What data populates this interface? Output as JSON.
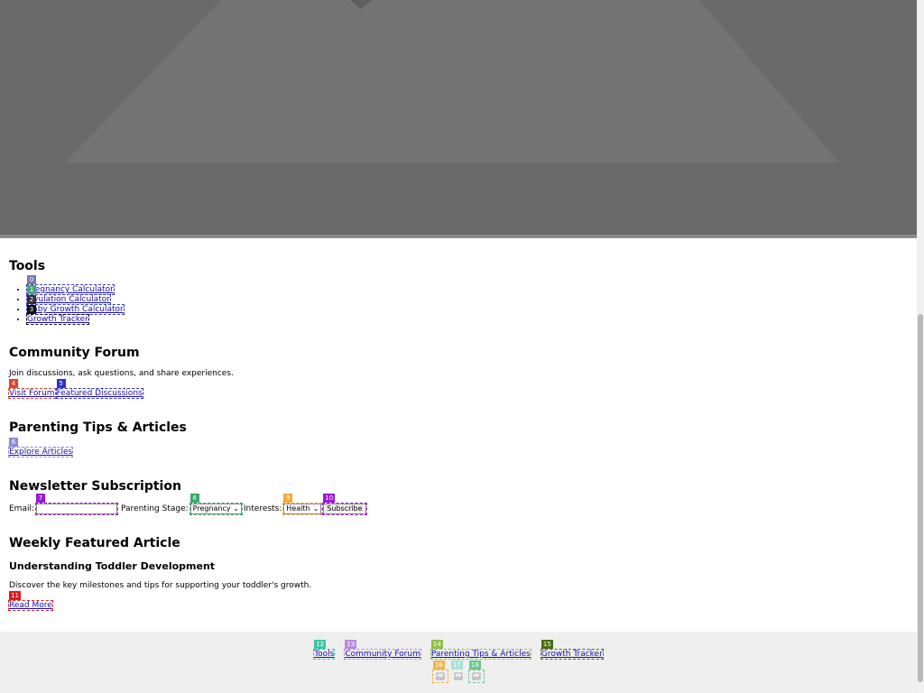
{
  "tools": {
    "title": "Tools",
    "items": [
      {
        "label": "Pregnancy Calculator",
        "badge": "0",
        "color": "#7a7aa8"
      },
      {
        "label": "Ovulation Calculator",
        "badge": "1",
        "color": "#3fae74"
      },
      {
        "label": "Baby Growth Calculator",
        "badge": "2",
        "color": "#333333"
      },
      {
        "label": "Growth Tracker",
        "badge": "3",
        "color": "#111111"
      }
    ]
  },
  "forum": {
    "title": "Community Forum",
    "description": "Join discussions, ask questions, and share experiences.",
    "visit_label": "Visit Forum",
    "visit_badge": "4",
    "featured_label": "Featured Discussions",
    "featured_badge": "5"
  },
  "tips": {
    "title": "Parenting Tips & Articles",
    "explore_label": "Explore Articles",
    "explore_badge": "6"
  },
  "newsletter": {
    "title": "Newsletter Subscription",
    "email_label": "Email:",
    "email_value": "",
    "email_badge": "7",
    "stage_label": "Parenting Stage:",
    "stage_value": "Pregnancy",
    "stage_badge": "8",
    "interests_label": "Interests:",
    "interests_value": "Health",
    "interests_badge": "9",
    "subscribe_label": "Subscribe",
    "subscribe_badge": "10"
  },
  "featured": {
    "title": "Weekly Featured Article",
    "article_title": "Understanding Toddler Development",
    "article_desc": "Discover the key milestones and tips for supporting your toddler's growth.",
    "read_more_label": "Read More",
    "read_more_badge": "11"
  },
  "footer": {
    "links": [
      {
        "label": "Tools",
        "badge": "12",
        "color": "#3ec4a6"
      },
      {
        "label": "Community Forum",
        "badge": "13",
        "color": "#b78be0"
      },
      {
        "label": "Parenting Tips & Articles",
        "badge": "14",
        "color": "#8fbf4a"
      },
      {
        "label": "Growth Tracker",
        "badge": "15",
        "color": "#4a6d12"
      }
    ],
    "icons": [
      {
        "name": "social-icon-1",
        "badge": "16",
        "color": "#f2b44a"
      },
      {
        "name": "social-icon-2",
        "badge": "17",
        "color": "#a6e3d6"
      },
      {
        "name": "social-icon-3",
        "badge": "18",
        "color": "#6cc88a"
      }
    ]
  },
  "colors": {
    "link": "#1a0dab",
    "badge_visit": "#e0452a",
    "badge_featured": "#3030d0",
    "badge_explore": "#8a8ad8",
    "badge_email": "#9a1ad0",
    "badge_stage": "#3aa86a",
    "badge_interests": "#f2a93a",
    "badge_subscribe": "#9a1ad0",
    "badge_readmore": "#e01a1a"
  }
}
